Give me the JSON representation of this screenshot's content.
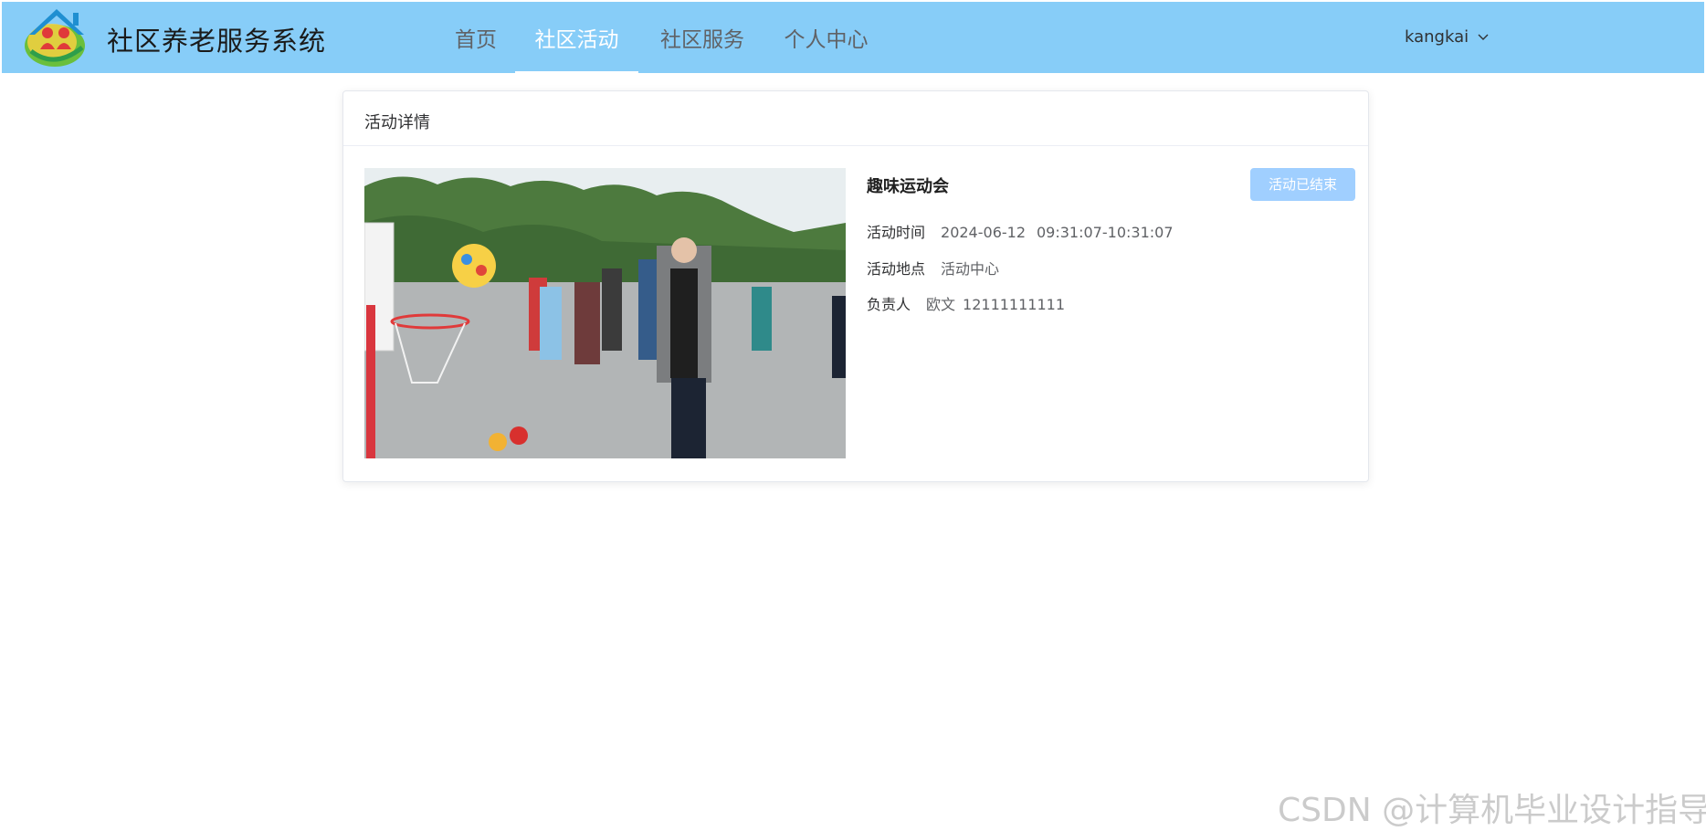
{
  "app": {
    "title": "社区养老服务系统"
  },
  "nav": {
    "items": [
      {
        "label": "首页",
        "active": false
      },
      {
        "label": "社区活动",
        "active": true
      },
      {
        "label": "社区服务",
        "active": false
      },
      {
        "label": "个人中心",
        "active": false
      }
    ]
  },
  "user": {
    "name": "kangkai",
    "icon": "chevron-down-icon"
  },
  "card": {
    "title": "活动详情"
  },
  "event": {
    "name": "趣味运动会",
    "status_label": "活动已结束",
    "time_label": "活动时间",
    "date": "2024-06-12",
    "time_range": "09:31:07-10:31:07",
    "location_label": "活动地点",
    "location": "活动中心",
    "owner_label": "负责人",
    "owner_name": "欧文",
    "owner_phone": "12111111111"
  },
  "watermark": "CSDN @计算机毕业设计指导",
  "colors": {
    "header_bg": "#87cdf8",
    "accent_disabled": "#a0cfff",
    "nav_active": "#ffffff"
  }
}
